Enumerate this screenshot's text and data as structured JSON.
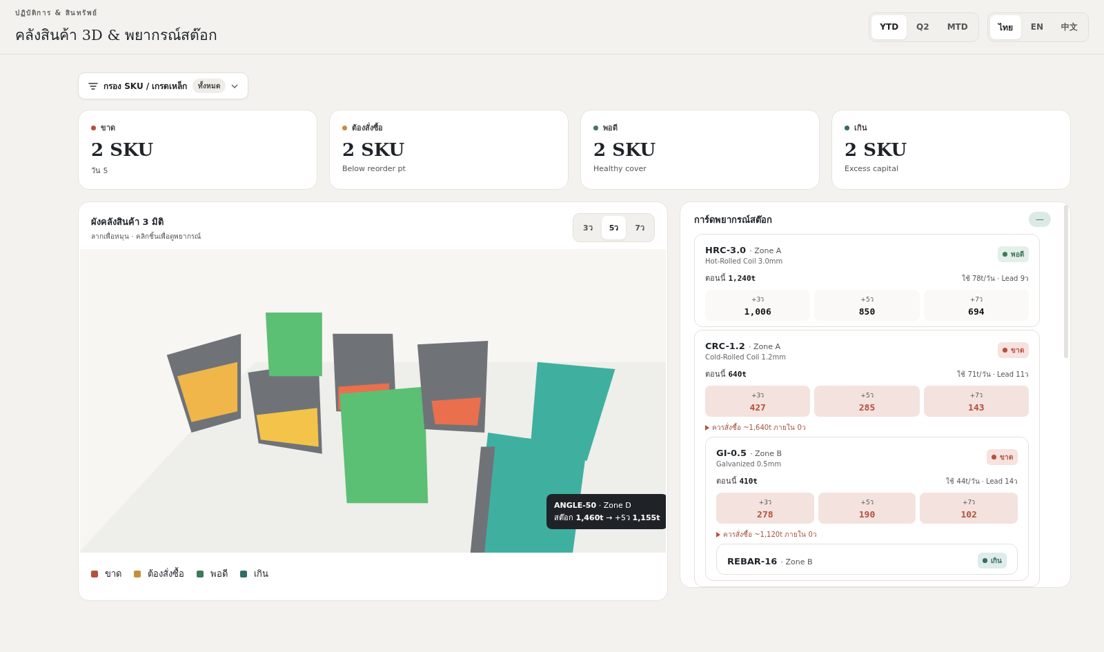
{
  "header": {
    "eyebrow": "ปฏิบัติการ & สินทรัพย์",
    "title": "คลังสินค้า 3D & พยากรณ์สต๊อก"
  },
  "period_tabs": [
    {
      "label": "YTD",
      "selected": true
    },
    {
      "label": "Q2",
      "selected": false
    },
    {
      "label": "MTD",
      "selected": false
    }
  ],
  "language_tabs": [
    {
      "label": "ไทย",
      "selected": true
    },
    {
      "label": "EN",
      "selected": false
    },
    {
      "label": "中文",
      "selected": false
    }
  ],
  "filter": {
    "label": "กรอง SKU / เกรดเหล็ก",
    "value": "ทั้งหมด"
  },
  "kpis": [
    {
      "label": "ขาด",
      "value": "2 SKU",
      "note": "วัน 5",
      "color": "#b5503d"
    },
    {
      "label": "ต้องสั่งซื้อ",
      "value": "2 SKU",
      "note": "Below reorder pt",
      "color": "#c4903f"
    },
    {
      "label": "พอดี",
      "value": "2 SKU",
      "note": "Healthy cover",
      "color": "#3d7a5a"
    },
    {
      "label": "เกิน",
      "value": "2 SKU",
      "note": "Excess capital",
      "color": "#2e6e66"
    }
  ],
  "warehouse": {
    "title": "ผังคลังสินค้า 3 มิติ",
    "subtitle": "ลากเพื่อหมุน · คลิกชิ้นเพื่อดูพยากรณ์",
    "horizon_tabs": [
      {
        "label": "3ว",
        "selected": false
      },
      {
        "label": "5ว",
        "selected": true
      },
      {
        "label": "7ว",
        "selected": false
      }
    ],
    "tooltip": {
      "sku": "ANGLE-50",
      "zone": "· Zone D",
      "text": "สต๊อก **1,460t** → +5ว **1,155t**"
    },
    "legend": [
      {
        "label": "ขาด",
        "color": "#b5503d"
      },
      {
        "label": "ต้องสั่งซื้อ",
        "color": "#c4903f"
      },
      {
        "label": "พอดี",
        "color": "#3d7a5a"
      },
      {
        "label": "เกิน",
        "color": "#2e6e66"
      }
    ]
  },
  "forecast": {
    "title": "การ์ดพยากรณ์สต๊อก",
    "collapse_symbol": "—",
    "cards": [
      {
        "sku": "HRC-3.0",
        "zone": "· Zone A",
        "name": "Hot-Rolled Coil 3.0mm",
        "kind": "ok",
        "badge": "พอดี",
        "now_label": "ตอนนี้",
        "now": "1,240t",
        "usage": "ใช้ 78t/วัน · Lead 9ว",
        "cells": [
          {
            "label": "+3ว",
            "value": "1,006"
          },
          {
            "label": "+5ว",
            "value": "850"
          },
          {
            "label": "+7ว",
            "value": "694"
          }
        ]
      },
      {
        "sku": "CRC-1.2",
        "zone": "· Zone A",
        "name": "Cold-Rolled Coil 1.2mm",
        "kind": "short",
        "badge": "ขาด",
        "now_label": "ตอนนี้",
        "now": "640t",
        "usage": "ใช้ 71t/วัน · Lead 11ว",
        "cells": [
          {
            "label": "+3ว",
            "value": "427"
          },
          {
            "label": "+5ว",
            "value": "285"
          },
          {
            "label": "+7ว",
            "value": "143"
          }
        ],
        "note": "ควรสั่งซื้อ ~1,640t ภายใน 0ว",
        "children": [
          {
            "sku": "GI-0.5",
            "zone": "· Zone B",
            "name": "Galvanized 0.5mm",
            "kind": "short",
            "badge": "ขาด",
            "now_label": "ตอนนี้",
            "now": "410t",
            "usage": "ใช้ 44t/วัน · Lead 14ว",
            "cells": [
              {
                "label": "+3ว",
                "value": "278"
              },
              {
                "label": "+5ว",
                "value": "190"
              },
              {
                "label": "+7ว",
                "value": "102"
              }
            ],
            "note": "ควรสั่งซื้อ ~1,120t ภายใน 0ว",
            "children": [
              {
                "sku": "REBAR-16",
                "zone": "· Zone B",
                "kind": "excess",
                "badge": "เกิน"
              }
            ]
          }
        ]
      }
    ]
  }
}
